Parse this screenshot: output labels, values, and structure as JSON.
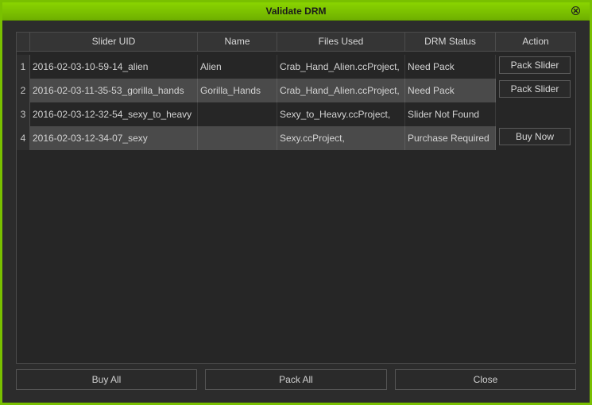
{
  "window": {
    "title": "Validate DRM"
  },
  "columns": [
    "Slider UID",
    "Name",
    "Files Used",
    "DRM Status",
    "Action"
  ],
  "rows": [
    {
      "num": "1",
      "uid": "2016-02-03-10-59-14_alien",
      "name": "Alien",
      "files": "Crab_Hand_Alien.ccProject,",
      "status": "Need Pack",
      "action": "Pack Slider"
    },
    {
      "num": "2",
      "uid": "2016-02-03-11-35-53_gorilla_hands",
      "name": "Gorilla_Hands",
      "files": "Crab_Hand_Alien.ccProject,",
      "status": "Need Pack",
      "action": "Pack Slider"
    },
    {
      "num": "3",
      "uid": "2016-02-03-12-32-54_sexy_to_heavy",
      "name": "",
      "files": "Sexy_to_Heavy.ccProject,",
      "status": "Slider Not Found",
      "action": ""
    },
    {
      "num": "4",
      "uid": "2016-02-03-12-34-07_sexy",
      "name": "",
      "files": "Sexy.ccProject,",
      "status": "Purchase Required",
      "action": "Buy Now"
    }
  ],
  "footer": {
    "buy_all": "Buy All",
    "pack_all": "Pack All",
    "close": "Close"
  },
  "colors": {
    "accent": "#79c000",
    "background": "#2c2c2c",
    "row_alt": "#4a4a4a"
  }
}
